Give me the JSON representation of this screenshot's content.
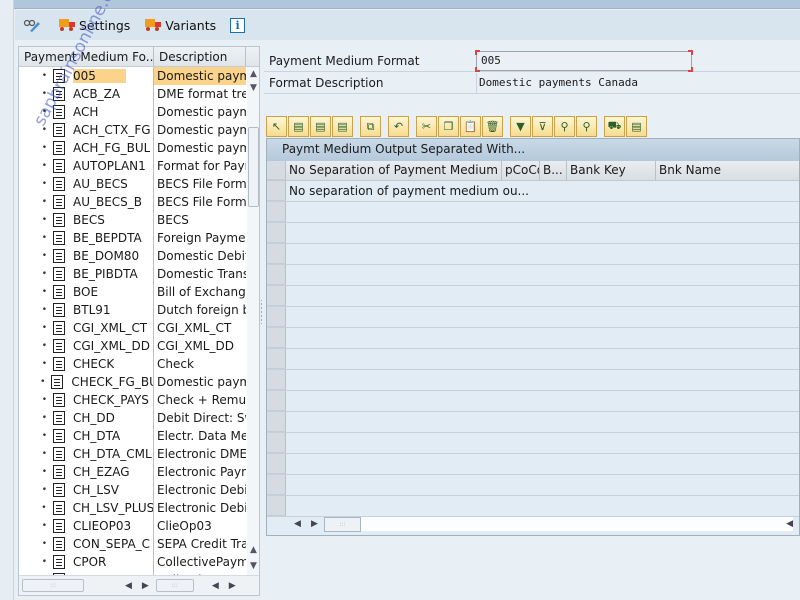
{
  "toolbar": {
    "settings_label": "Settings",
    "variants_label": "Variants",
    "info_glyph": "i"
  },
  "tree": {
    "col1_header": "Payment Medium Fo...",
    "col2_header": "Description",
    "selected_index": 0,
    "rows": [
      {
        "key": "005",
        "desc": "Domestic payme"
      },
      {
        "key": "ACB_ZA",
        "desc": "DME format tree"
      },
      {
        "key": "ACH",
        "desc": "Domestic payme"
      },
      {
        "key": "ACH_CTX_FG",
        "desc": "Domestic payme"
      },
      {
        "key": "ACH_FG_BUL",
        "desc": "Domestic payme"
      },
      {
        "key": "AUTOPLAN1",
        "desc": "Format for Paym"
      },
      {
        "key": "AU_BECS",
        "desc": "BECS File Format"
      },
      {
        "key": "AU_BECS_B",
        "desc": "BECS File Format"
      },
      {
        "key": "BECS",
        "desc": "BECS"
      },
      {
        "key": "BE_BEPDTA",
        "desc": "Foreign Paymen"
      },
      {
        "key": "BE_DOM80",
        "desc": "Domestic Debit"
      },
      {
        "key": "BE_PIBDTA",
        "desc": "Domestic Transf"
      },
      {
        "key": "BOE",
        "desc": "Bill of Exchange"
      },
      {
        "key": "BTL91",
        "desc": "Dutch foreign b"
      },
      {
        "key": "CGI_XML_CT",
        "desc": "CGI_XML_CT"
      },
      {
        "key": "CGI_XML_DD",
        "desc": "CGI_XML_DD"
      },
      {
        "key": "CHECK",
        "desc": "Check"
      },
      {
        "key": "CHECK_FG_BU",
        "desc": "Domestic payme"
      },
      {
        "key": "CHECK_PAYS",
        "desc": "Check + Remun"
      },
      {
        "key": "CH_DD",
        "desc": "Debit Direct: Sw"
      },
      {
        "key": "CH_DTA",
        "desc": "Electr. Data Med"
      },
      {
        "key": "CH_DTA_CML",
        "desc": "Electronic DME I"
      },
      {
        "key": "CH_EZAG",
        "desc": "Electronic Paym"
      },
      {
        "key": "CH_LSV",
        "desc": "Electronic Debit"
      },
      {
        "key": "CH_LSV_PLUS",
        "desc": "Electronic Debit"
      },
      {
        "key": "CLIEOP03",
        "desc": "ClieOp03"
      },
      {
        "key": "CON_SEPA_C",
        "desc": "SEPA Credit Tra"
      },
      {
        "key": "CPOR",
        "desc": "CollectivePayme"
      },
      {
        "key": "CPOR_BULK",
        "desc": "CollectivePayme"
      }
    ]
  },
  "form": {
    "format_label": "Payment Medium Format",
    "format_value": "005",
    "desc_label": "Format Description",
    "desc_value": "Domestic payments Canada"
  },
  "alv_toolbar": [
    {
      "name": "details-icon",
      "group": 1
    },
    {
      "name": "select-all-icon",
      "group": 1
    },
    {
      "name": "select-block-icon",
      "group": 1
    },
    {
      "name": "deselect-all-icon",
      "group": 1
    },
    {
      "name": "copy-row-icon",
      "group": 2
    },
    {
      "name": "undo-icon",
      "group": 3
    },
    {
      "name": "cut-icon",
      "group": 4
    },
    {
      "name": "copy-icon",
      "group": 4
    },
    {
      "name": "paste-icon",
      "group": 4
    },
    {
      "name": "delete-icon",
      "group": 4
    },
    {
      "name": "filter-icon",
      "group": 5
    },
    {
      "name": "undo-filter-icon",
      "group": 5
    },
    {
      "name": "find-icon",
      "group": 5
    },
    {
      "name": "find-next-icon",
      "group": 5
    },
    {
      "name": "transport-icon",
      "group": 6
    },
    {
      "name": "document-icon",
      "group": 6
    }
  ],
  "grid": {
    "title": "Paymt Medium Output Separated With...",
    "columns": [
      "No Separation of Payment Medium ...",
      "pCoCd",
      "B...",
      "Bank Key",
      "Bnk Name"
    ],
    "rows": [
      [
        "No separation of payment medium ou...",
        "",
        "",
        "",
        ""
      ]
    ],
    "visible_row_count": 16
  },
  "watermark": "sapbrainsonline.com"
}
